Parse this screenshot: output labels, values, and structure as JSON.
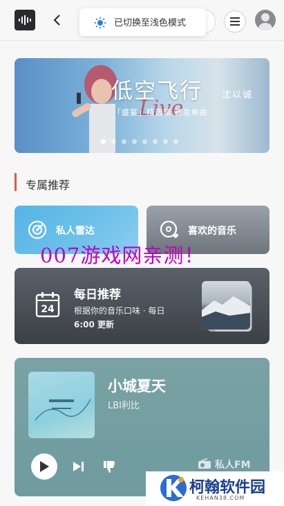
{
  "toast": {
    "text": "已切换至浅色模式"
  },
  "banner": {
    "title": "低空飞行",
    "artist": "沈以诚",
    "subtitle": "「盛宴」精选辑 首发单曲",
    "live_text": "Live",
    "dots_count": 8,
    "active_dot": 0
  },
  "section": {
    "title": "专属推荐"
  },
  "cards": {
    "radar": {
      "label": "私人雷达"
    },
    "liked": {
      "label": "喜欢的音乐"
    }
  },
  "daily": {
    "title": "每日推荐",
    "day": "24",
    "desc_line1": "根据你的音乐口味 · 每日",
    "desc_line2": "6:00 更新"
  },
  "fm": {
    "song": "小城夏天",
    "artist": "LBI利比",
    "label": "私人FM"
  },
  "watermarks": {
    "red": "007游戏网亲测！",
    "brand": "柯翰软件园",
    "url": "KEHAN38.COM"
  },
  "colors": {
    "accent": "#e0564a",
    "radar_card": "#55b4e6",
    "fm_card": "#7aa2a4"
  }
}
